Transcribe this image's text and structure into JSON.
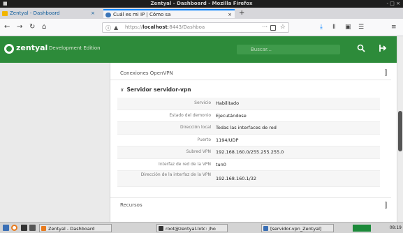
{
  "window": {
    "title": "Zentyal - Dashboard - Mozilla Firefox",
    "wm_left": "■",
    "wm_right": "- □ ×"
  },
  "tabs": [
    {
      "label": "Zentyal - Dashboard",
      "close": "×"
    },
    {
      "label": "Cuál es mi IP | Cómo sa",
      "close": "×"
    }
  ],
  "newtab": "+",
  "nav": {
    "back": "←",
    "forward": "→",
    "reload": "↻",
    "home": "⌂",
    "url_prefix": "https://",
    "url_host": "localhost",
    "url_rest": ":8443/Dashboa",
    "more": "···",
    "bookmark": "☆",
    "download": "⤓",
    "library": "Ⅱ",
    "sidebar_toggle": "▣",
    "extension": "☰",
    "menu": "≡"
  },
  "app": {
    "brand": "zentyal",
    "edition": "Development Edition",
    "search_placeholder": "Buscar...",
    "search_icon": "search-icon",
    "logout_icon": "logout-icon"
  },
  "cards": {
    "top_title": "Conexiones OpenVPN",
    "section_title": "Servidor servidor-vpn",
    "section_chevron": "∨",
    "bottom_title": "Recursos"
  },
  "rows": [
    {
      "key": "Servicio",
      "value": "Habilitado"
    },
    {
      "key": "Estado del demonio",
      "value": "Ejecutándose"
    },
    {
      "key": "Dirección local",
      "value": "Todas las interfaces de red"
    },
    {
      "key": "Puerto",
      "value": "1194/UDP"
    },
    {
      "key": "Subred VPN",
      "value": "192.168.160.0/255.255.255.0"
    },
    {
      "key": "Interfaz de red de la VPN",
      "value": "tun0"
    },
    {
      "key": "Dirección de la interfaz de la VPN",
      "value": "192.168.160.1/32"
    }
  ],
  "taskbar": {
    "win1": "Zentyal - Dashboard",
    "win2": "root@zentyal-lxtc: /ho",
    "win3": "[servidor-vpn_Zentyal]",
    "clock": "08:19"
  },
  "colors": {
    "header_green": "#2d8b3a",
    "accent_blue": "#0a84ff"
  }
}
